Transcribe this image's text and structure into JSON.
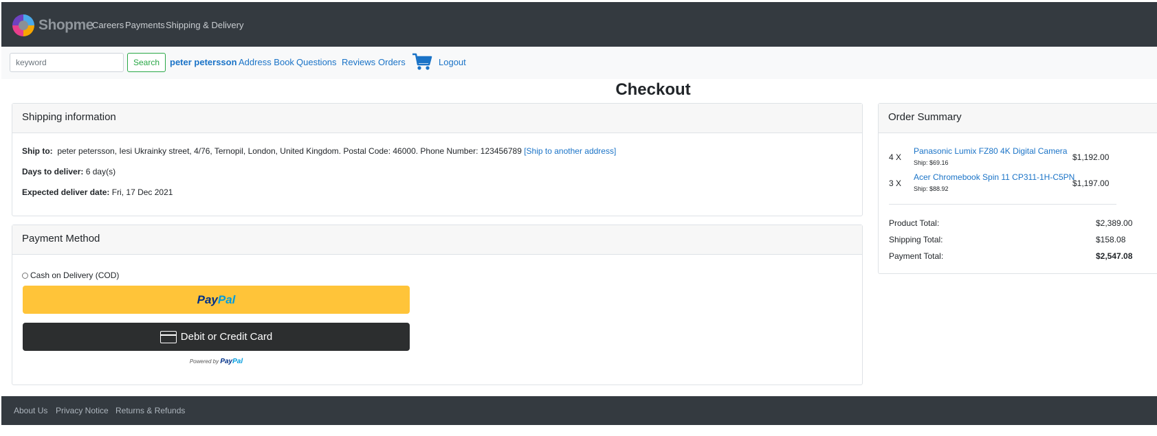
{
  "header": {
    "brand": "Shopme",
    "nav": [
      "Careers",
      "Payments",
      "Shipping & Delivery"
    ]
  },
  "subnav": {
    "search_placeholder": "keyword",
    "search_button": "Search",
    "user_name": "peter petersson",
    "links": [
      "Address Book",
      "Questions",
      "Reviews",
      "Orders"
    ],
    "cart_icon": "shopping-cart-icon",
    "logout": "Logout"
  },
  "page": {
    "title": "Checkout"
  },
  "shipping": {
    "header": "Shipping information",
    "ship_to_label": "Ship to:",
    "ship_to_value": "peter petersson, Iesi Ukrainky street, 4/76, Ternopil, London, United Kingdom. Postal Code: 46000. Phone Number: 123456789",
    "ship_another": "[Ship to another address]",
    "days_label": "Days to deliver:",
    "days_value": "6 day(s)",
    "expected_label": "Expected deliver date:",
    "expected_value": "Fri, 17 Dec 2021"
  },
  "payment": {
    "header": "Payment Method",
    "cod_label": "Cash on Delivery (COD)",
    "paypal_part1": "Pay",
    "paypal_part2": "Pal",
    "card_button": "Debit or Credit Card",
    "powered_by": "Powered by",
    "powered_brand1": "Pay",
    "powered_brand2": "Pal"
  },
  "summary": {
    "header": "Order Summary",
    "items": [
      {
        "qty": "4 X",
        "name": "Panasonic Lumix FZ80 4K Digital Camera",
        "ship": "Ship: $69.16",
        "price": "$1,192.00"
      },
      {
        "qty": "3 X",
        "name": "Acer Chromebook Spin 11 CP311-1H-C5PN",
        "ship": "Ship: $88.92",
        "price": "$1,197.00"
      }
    ],
    "product_total_label": "Product Total:",
    "product_total": "$2,389.00",
    "shipping_total_label": "Shipping Total:",
    "shipping_total": "$158.08",
    "payment_total_label": "Payment Total:",
    "payment_total": "$2,547.08"
  },
  "footer": {
    "links": [
      "About Us",
      "Privacy Notice",
      "Returns & Refunds"
    ]
  },
  "colors": {
    "nav_bg": "#343a40",
    "link": "#1a73c7",
    "paypal_yellow": "#ffc439",
    "success": "#28a745"
  }
}
